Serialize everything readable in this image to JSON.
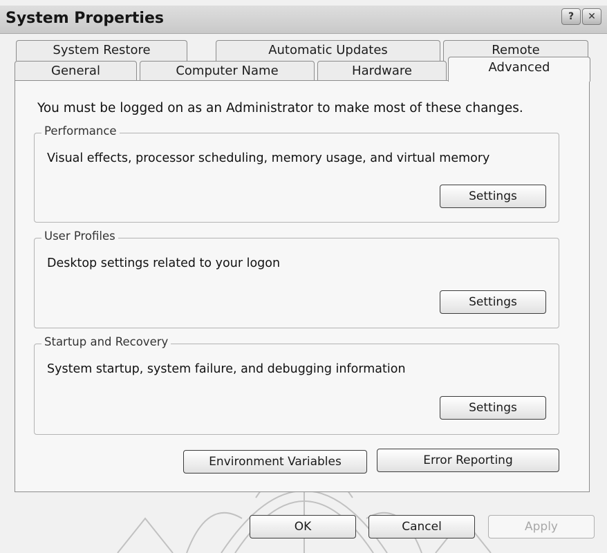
{
  "window": {
    "title": "System Properties"
  },
  "title_buttons": {
    "help_label": "?",
    "close_label": "✕"
  },
  "tabs_row1": [
    {
      "label": "System Restore"
    },
    {
      "label": "Automatic Updates"
    },
    {
      "label": "Remote"
    }
  ],
  "tabs_row2": [
    {
      "label": "General"
    },
    {
      "label": "Computer Name"
    },
    {
      "label": "Hardware"
    },
    {
      "label": "Advanced",
      "active": true
    }
  ],
  "advanced": {
    "admin_note": "You must be logged on as an Administrator to make most of these changes.",
    "performance": {
      "legend": "Performance",
      "description": "Visual effects, processor scheduling, memory usage, and virtual memory",
      "settings_label": "Settings"
    },
    "user_profiles": {
      "legend": "User Profiles",
      "description": "Desktop settings related to your logon",
      "settings_label": "Settings"
    },
    "startup_recovery": {
      "legend": "Startup and Recovery",
      "description": "System startup, system failure, and debugging information",
      "settings_label": "Settings"
    },
    "environment_variables_label": "Environment Variables",
    "error_reporting_label": "Error Reporting"
  },
  "footer": {
    "ok_label": "OK",
    "cancel_label": "Cancel",
    "apply_label": "Apply"
  }
}
